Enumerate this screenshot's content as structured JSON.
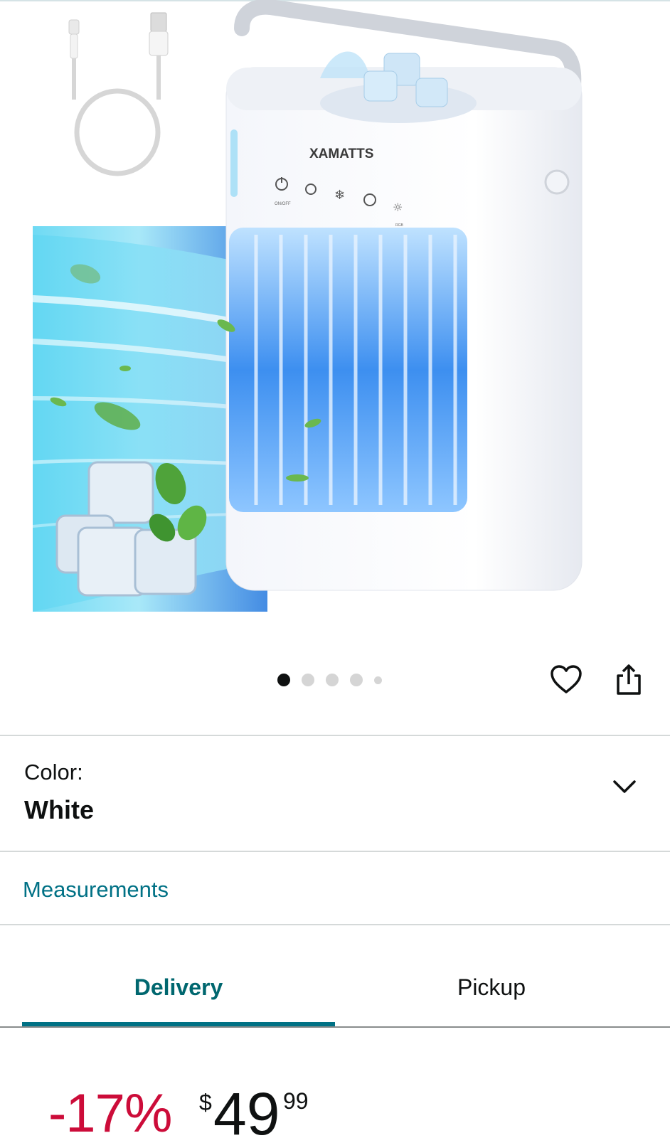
{
  "product": {
    "brand_text": "XAMATTS",
    "panel_labels": [
      "ON/OFF",
      "RGB"
    ]
  },
  "carousel": {
    "image_count": 5,
    "active_index": 0
  },
  "actions": {
    "wishlist_icon": "heart-icon",
    "share_icon": "share-icon"
  },
  "variation": {
    "label": "Color:",
    "value": "White",
    "dropdown_icon": "chevron-down-icon"
  },
  "measurements_link": "Measurements",
  "tabs": [
    {
      "label": "Delivery",
      "selected": true
    },
    {
      "label": "Pickup",
      "selected": false
    }
  ],
  "price": {
    "discount": "-17%",
    "currency_symbol": "$",
    "whole": "49",
    "fraction": "99"
  },
  "colors": {
    "link": "#007185",
    "tab_active": "#00676f",
    "discount": "#cc0c39",
    "text": "#0f1111"
  }
}
